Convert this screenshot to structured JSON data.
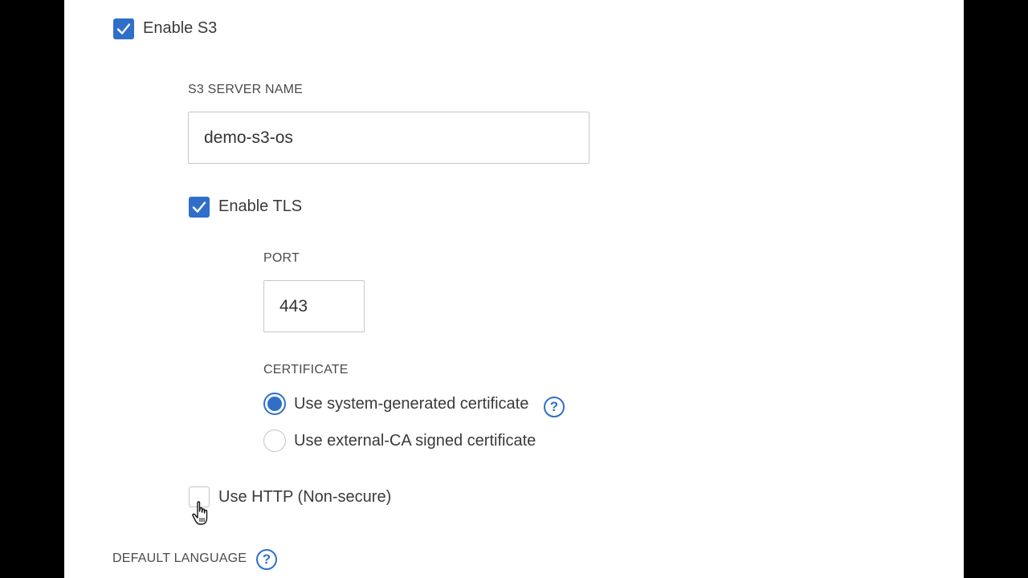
{
  "colors": {
    "accent": "#2f6fc9",
    "frame": "#000000",
    "panel": "#ffffff"
  },
  "enable_s3": {
    "label": "Enable S3",
    "checked": true
  },
  "s3_server_name": {
    "label": "S3 SERVER NAME",
    "value": "demo-s3-os"
  },
  "enable_tls": {
    "label": "Enable TLS",
    "checked": true
  },
  "port": {
    "label": "PORT",
    "value": "443"
  },
  "certificate": {
    "label": "CERTIFICATE",
    "options": [
      {
        "label": "Use system-generated certificate",
        "selected": true,
        "help_icon": "question-circle-icon"
      },
      {
        "label": "Use external-CA signed certificate",
        "selected": false
      }
    ]
  },
  "use_http": {
    "label": "Use HTTP (Non-secure)",
    "checked": false
  },
  "default_language": {
    "label": "DEFAULT LANGUAGE",
    "help_icon": "question-circle-icon"
  },
  "cursor": "hand-pointer-cursor-icon"
}
